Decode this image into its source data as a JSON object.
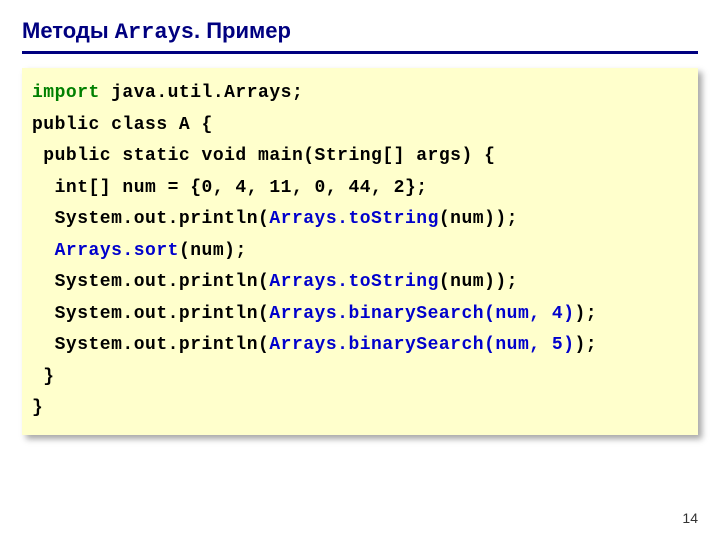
{
  "title": {
    "part1": "Методы ",
    "code": "Arrays",
    "part2": ". Пример"
  },
  "code": {
    "l1a": "import",
    "l1b": " java.util.Arrays;",
    "l2": "public class A {",
    "l3": " public static void main(String[] args) {",
    "l4": "  int[] num = {0, 4, 11, 0, 44, 2};",
    "l5a": "  System.out.println(",
    "l5b": "Arrays.toString",
    "l5c": "(num));",
    "l6a": "  ",
    "l6b": "Arrays.sort",
    "l6c": "(num);",
    "l7a": "  System.out.println(",
    "l7b": "Arrays.toString",
    "l7c": "(num));",
    "l8a": "  System.out.println(",
    "l8b": "Arrays.binarySearch(num, 4)",
    "l8c": ");",
    "l9a": "  System.out.println(",
    "l9b": "Arrays.binarySearch(num, 5)",
    "l9c": ");",
    "l10": " }",
    "l11": "}"
  },
  "page_number": "14"
}
